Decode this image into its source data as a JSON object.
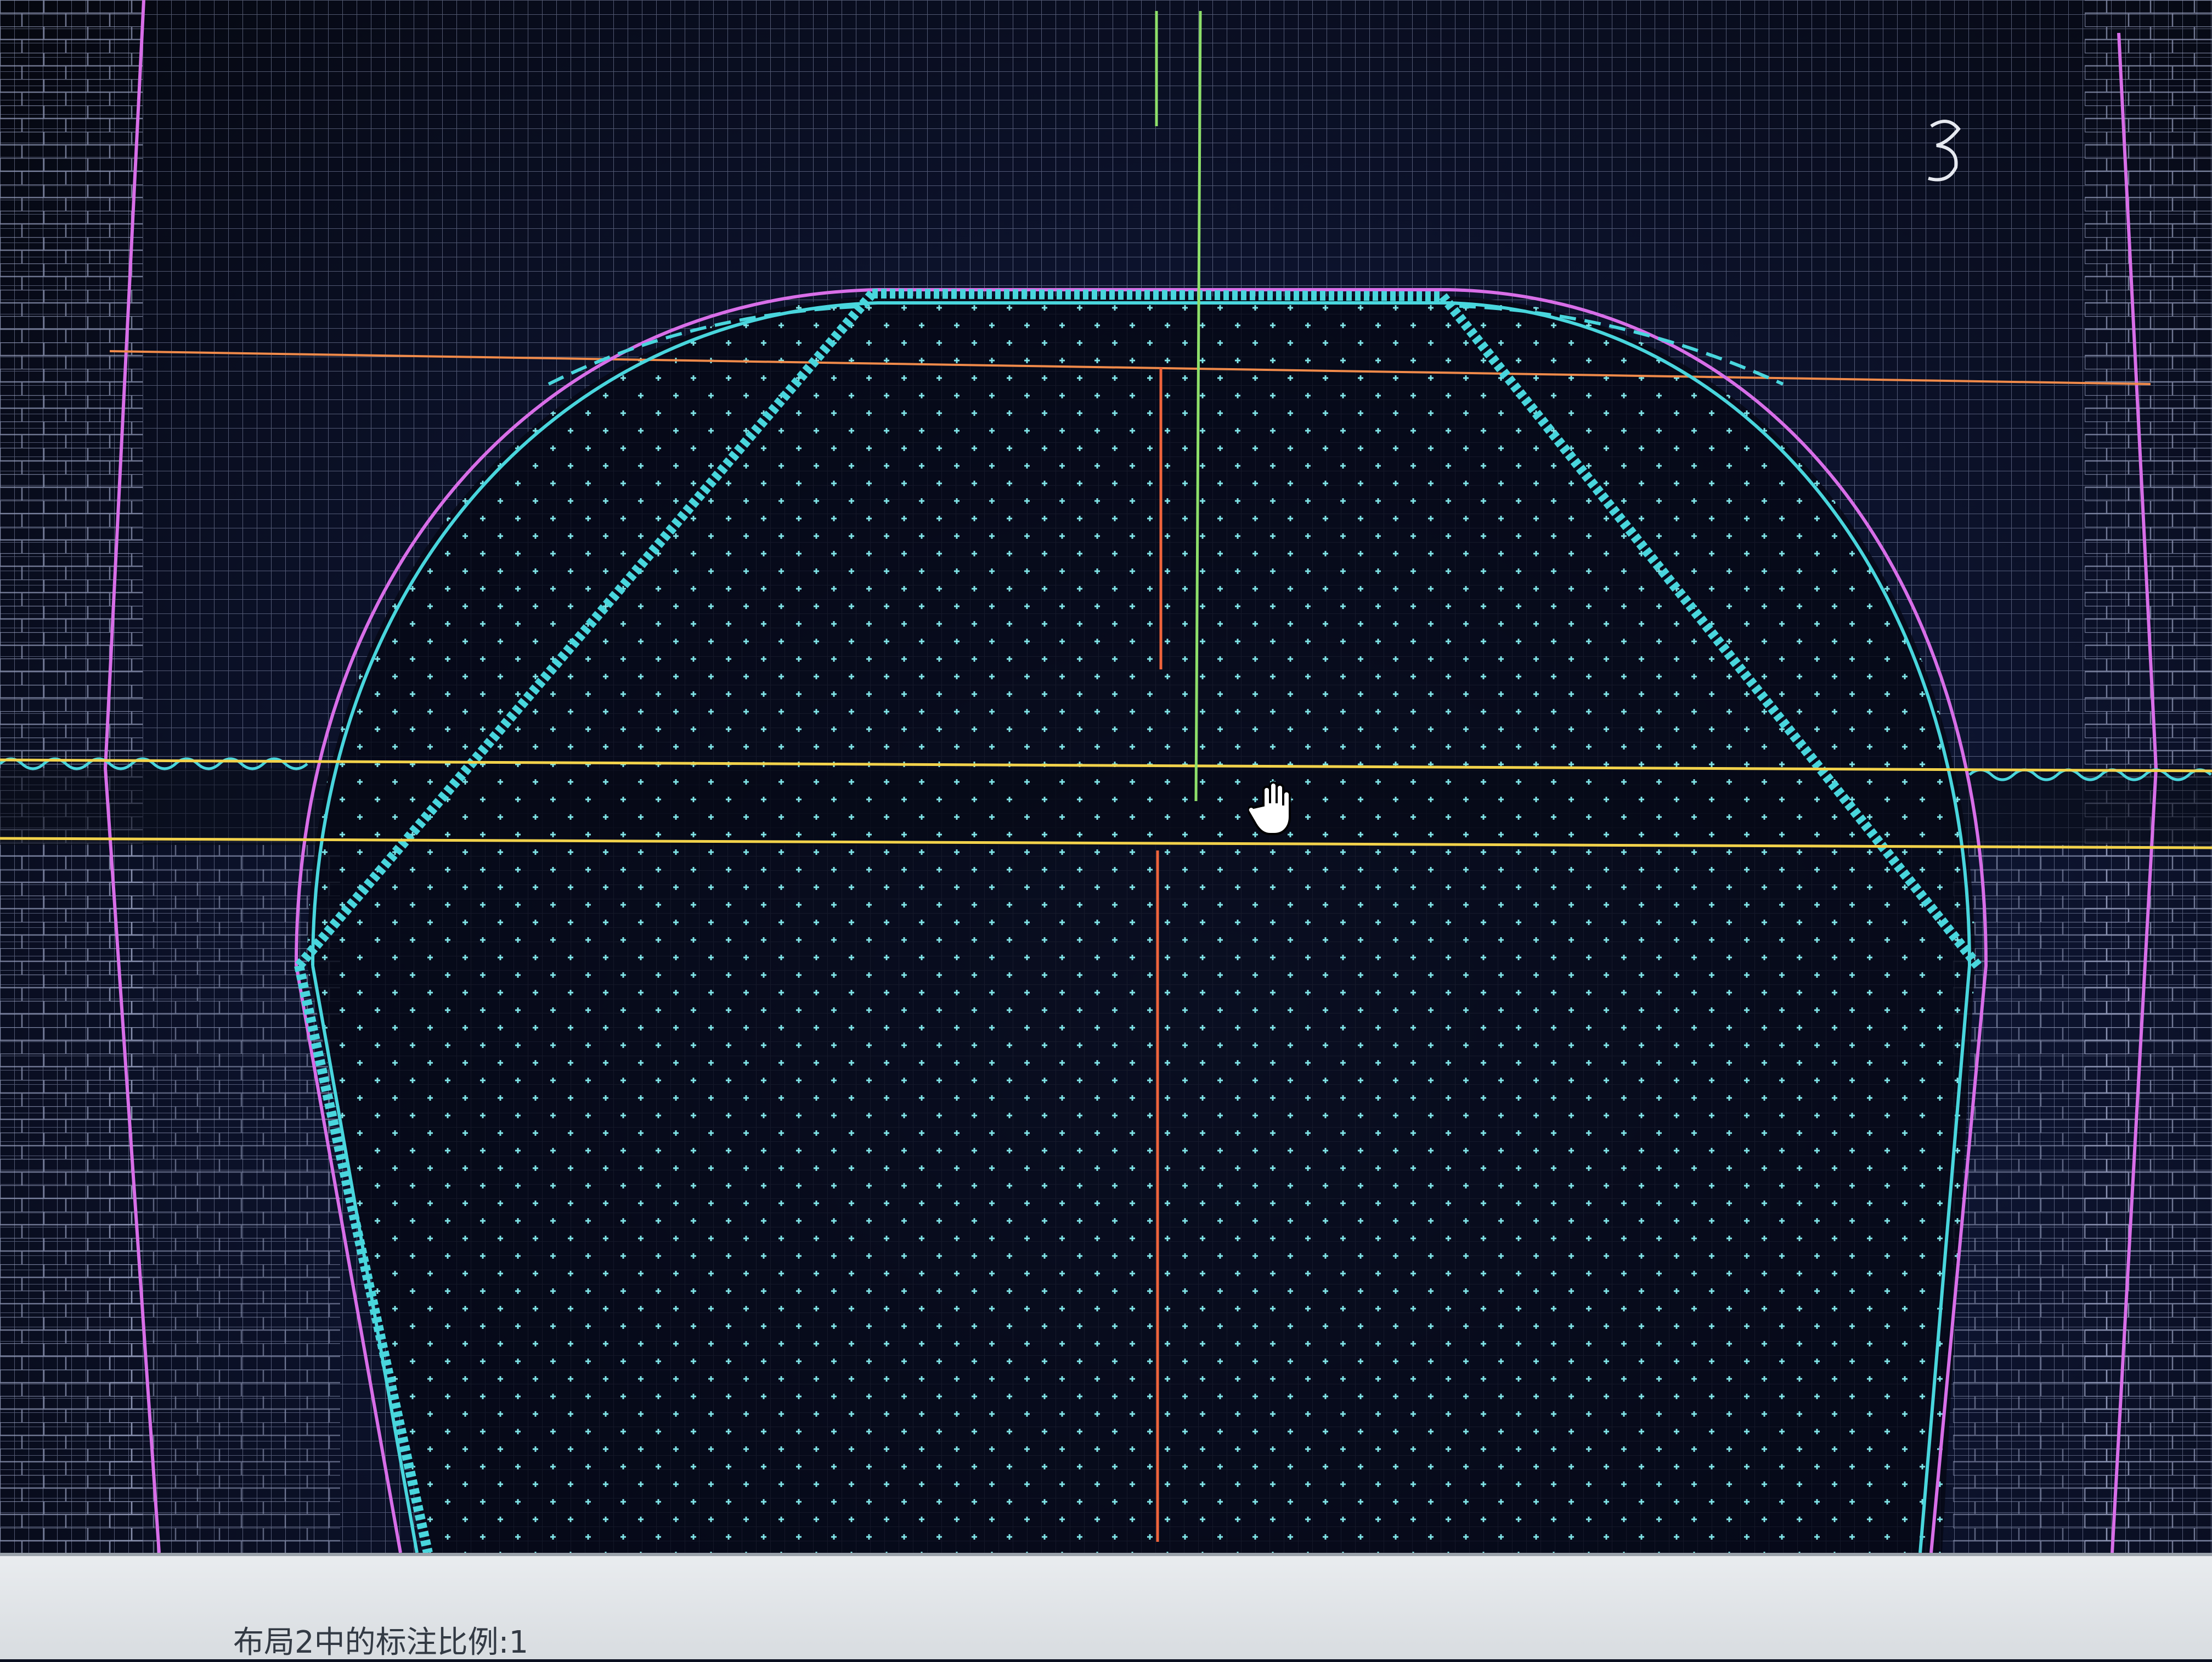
{
  "app": {
    "viewport": {
      "background_color": "#0b1020",
      "grid_color": "#8d96b8",
      "hatch_dot_color": "#7fe3e6",
      "line_colors": {
        "profile_outer": "#d86ee8",
        "profile_inner": "#49d6dd",
        "chamfer_zigzag": "#49d6dd",
        "center_vertical": "#8ee06a",
        "section_vertical": "#f0643c",
        "horizontal_reference": "#f2d24b",
        "horizontal_upper": "#f08a4a",
        "wave_break": "#49d6dd"
      },
      "cursor": "pan-hand-icon"
    },
    "status_bar": {
      "annotation_scale_text": "布局2中的标注比例:1"
    }
  }
}
